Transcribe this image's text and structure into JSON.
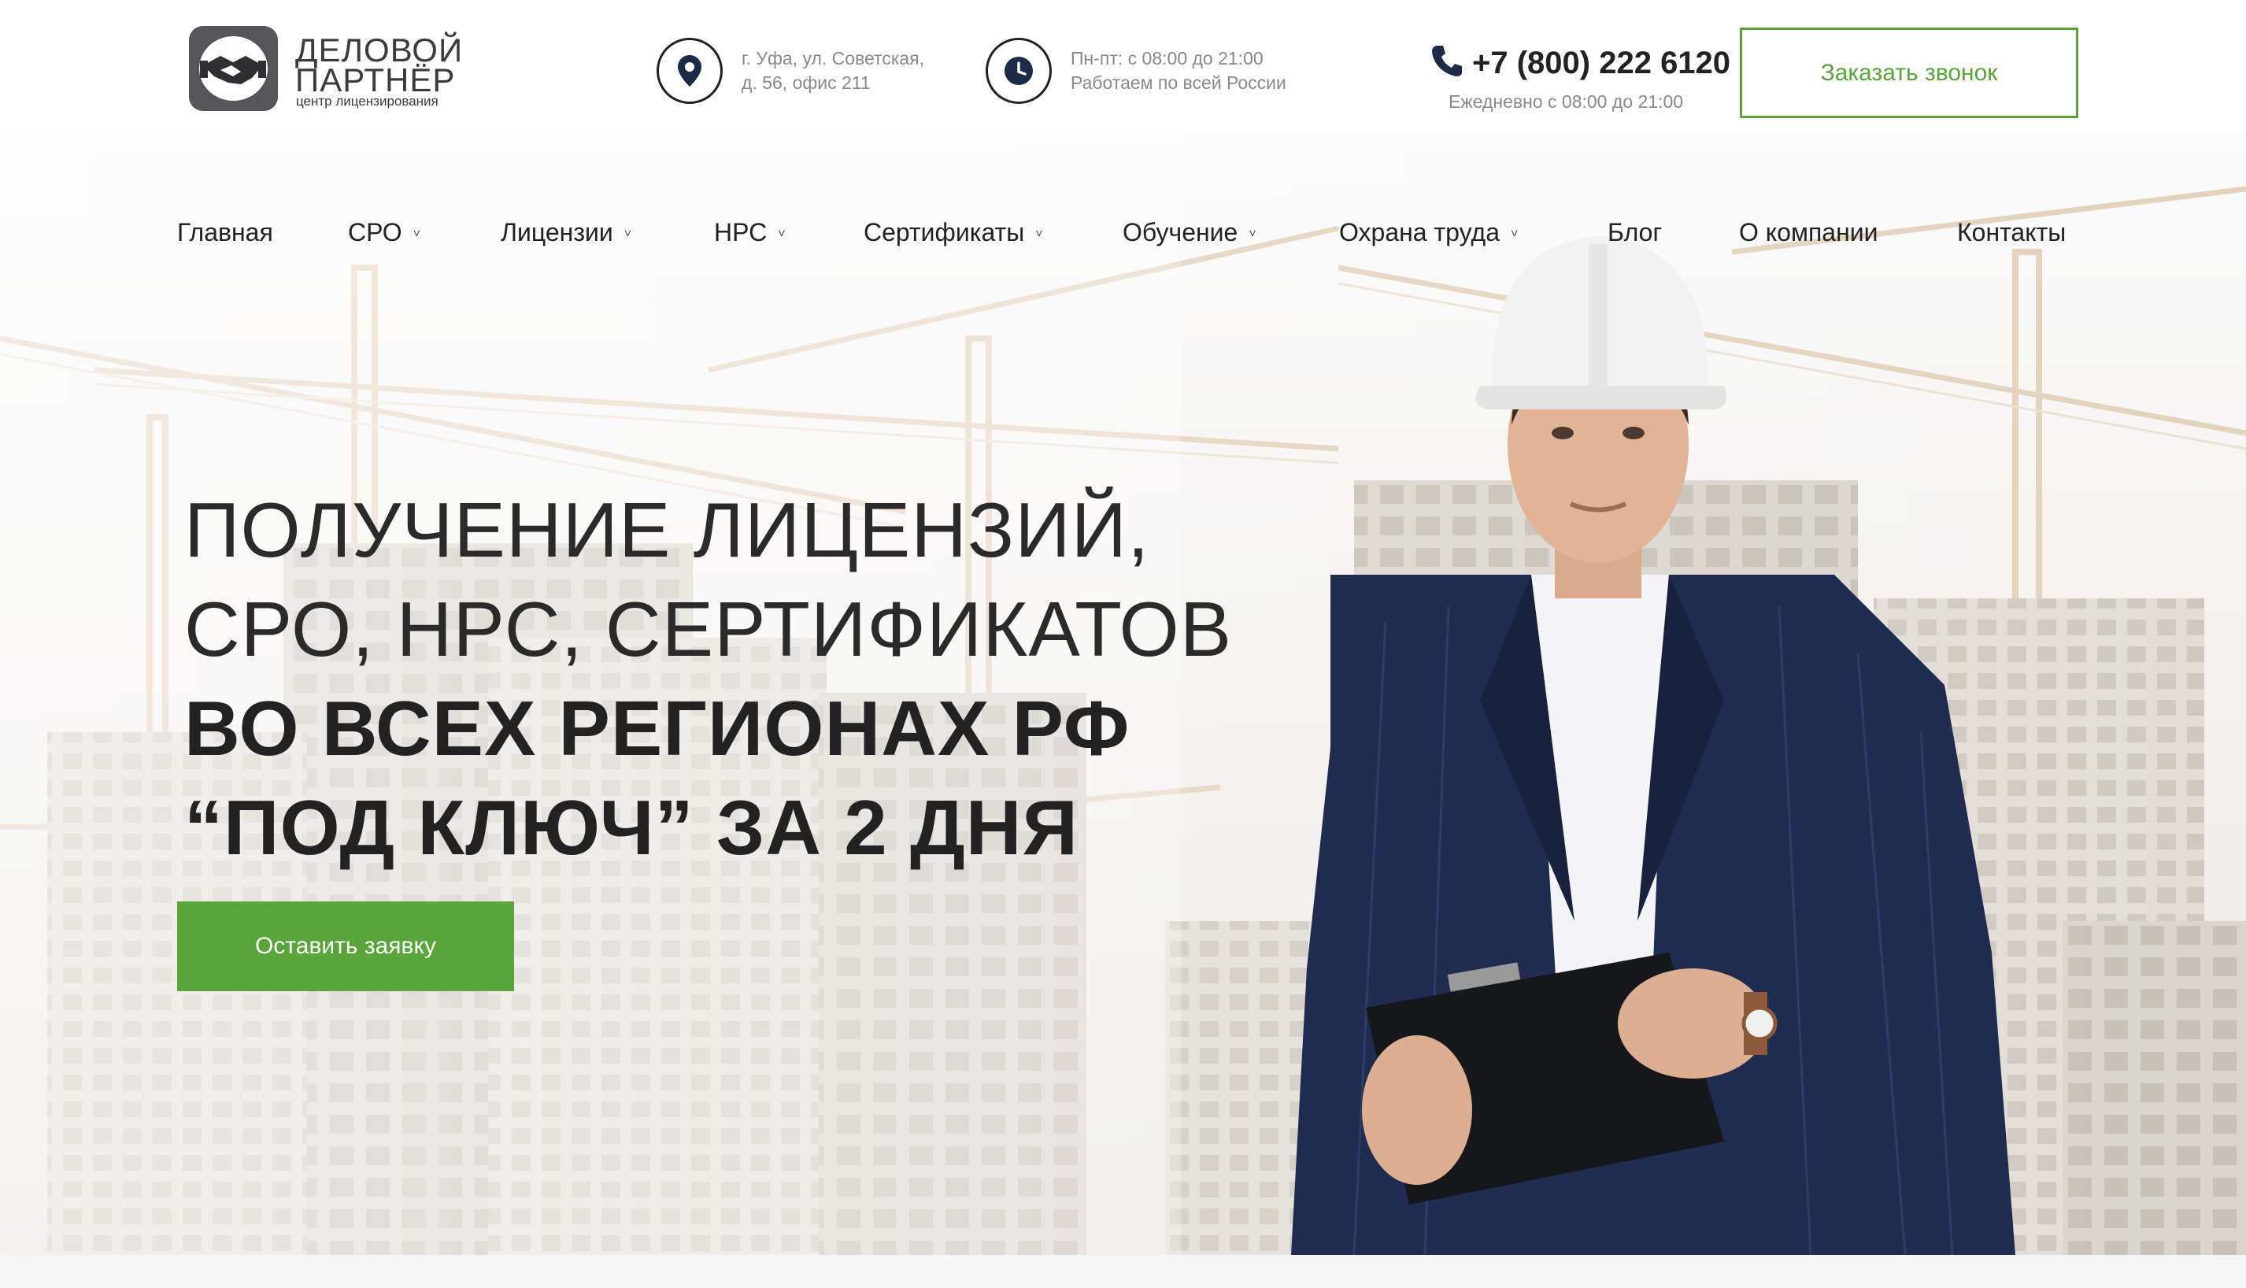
{
  "header": {
    "logo": {
      "line1": "ДЕЛОВОЙ",
      "line2": "ПАРТНЁР",
      "line3": "центр лицензирования",
      "icon": "handshake-icon"
    },
    "address": {
      "icon": "map-pin-icon",
      "line1": "г. Уфа, ул. Советская,",
      "line2": "д. 56, офис 211"
    },
    "hours": {
      "icon": "clock-icon",
      "line1": "Пн-пт: с 08:00 до 21:00",
      "line2": "Работаем по всей России"
    },
    "phone": {
      "icon": "phone-icon",
      "number": "+7 (800) 222 6120",
      "hours": "Ежедневно с 08:00 до 21:00"
    },
    "callback_label": "Заказать звонок"
  },
  "nav": {
    "items": [
      {
        "label": "Главная",
        "dropdown": false
      },
      {
        "label": "СРО",
        "dropdown": true
      },
      {
        "label": "Лицензии",
        "dropdown": true
      },
      {
        "label": "НРС",
        "dropdown": true
      },
      {
        "label": "Сертификаты",
        "dropdown": true
      },
      {
        "label": "Обучение",
        "dropdown": true
      },
      {
        "label": "Охрана труда",
        "dropdown": true
      },
      {
        "label": "Блог",
        "dropdown": false
      },
      {
        "label": "О компании",
        "dropdown": false
      },
      {
        "label": "Контакты",
        "dropdown": false
      }
    ],
    "chevron": "˅"
  },
  "hero": {
    "line1": "ПОЛУЧЕНИЕ ЛИЦЕНЗИЙ,",
    "line2": "СРО, НРС, СЕРТИФИКАТОВ",
    "line3": "ВО ВСЕХ РЕГИОНАХ РФ",
    "line4": "“ПОД КЛЮЧ” ЗА 2 ДНЯ",
    "cta_label": "Оставить заявку"
  },
  "colors": {
    "accent_green": "#5aa53b",
    "text_dark": "#222222",
    "text_muted": "#8a8a8a",
    "suit_navy": "#1f2b4f"
  }
}
